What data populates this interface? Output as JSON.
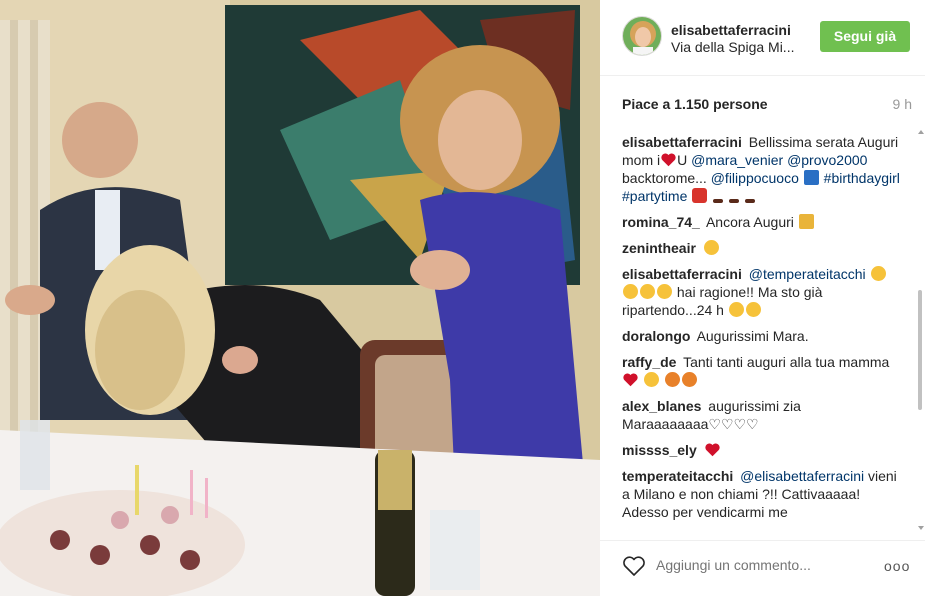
{
  "post": {
    "username": "elisabettaferracini",
    "location": "Via della Spiga Mi...",
    "follow_label": "Segui già",
    "likes": "Piace a 1.150 persone",
    "time": "9 h"
  },
  "colors": {
    "follow_button": "#70c050",
    "mention": "#003569",
    "text": "#262626",
    "muted": "#999999"
  },
  "caption": {
    "user": "elisabettaferracini",
    "text1": "Bellissima serata Auguri mom i",
    "text2": "U",
    "mention1": "@mara_venier",
    "mention2": "@provo2000",
    "text3": "backtorome...",
    "mention3": "@filippocuoco",
    "hashtag1": "#birthdaygirl",
    "hashtag2": "#partytime"
  },
  "comments": [
    {
      "user": "romina_74_",
      "text": "Ancora Auguri"
    },
    {
      "user": "zenintheair",
      "text": ""
    },
    {
      "user": "elisabettaferracini",
      "mention": "@temperateitacchi",
      "text": "hai ragione!! Ma sto già ripartendo...24 h"
    },
    {
      "user": "doralongo",
      "text": "Augurissimi Mara."
    },
    {
      "user": "raffy_de",
      "text": "Tanti tanti auguri alla tua mamma"
    },
    {
      "user": "alex_blanes",
      "text": "augurissimi zia Maraaaaaaaa♡♡♡♡"
    },
    {
      "user": "missss_ely",
      "text": ""
    },
    {
      "user": "temperateitacchi",
      "mention": "@elisabettaferracini",
      "text": "vieni a Milano e non chiami ?!! Cattivaaaaa! Adesso per vendicarmi me"
    }
  ],
  "footer": {
    "comment_placeholder": "Aggiungi un commento...",
    "more_label": "ooo"
  },
  "icons": {
    "like": "heart-outline-icon",
    "more": "more-options-icon"
  }
}
